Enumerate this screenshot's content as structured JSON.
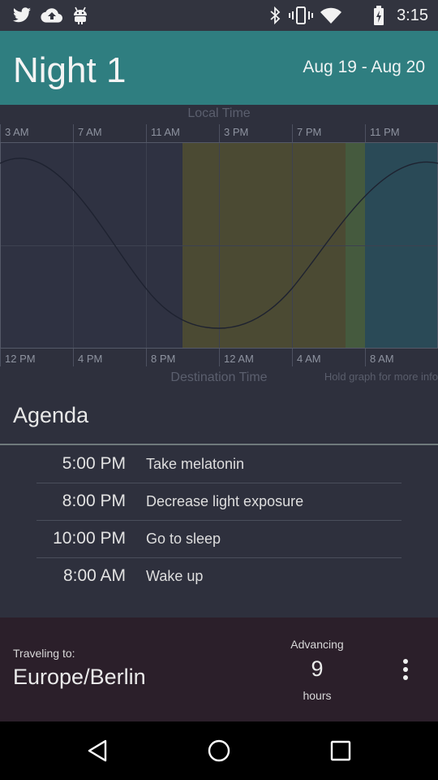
{
  "status_bar": {
    "time": "3:15",
    "left_icons": [
      "twitter-icon",
      "cloud-upload-icon",
      "android-icon"
    ],
    "right_icons": [
      "bluetooth-icon",
      "vibrate-icon",
      "wifi-icon",
      "battery-charging-icon"
    ]
  },
  "header": {
    "title": "Night 1",
    "date_range": "Aug 19 - Aug 20",
    "color": "#2f7e80"
  },
  "graph": {
    "top_axis_label": "Local Time",
    "bottom_axis_label": "Destination Time",
    "hint": "Hold graph for more info",
    "top_ticks": [
      "3 AM",
      "7 AM",
      "11 AM",
      "3 PM",
      "7 PM",
      "11 PM"
    ],
    "bottom_ticks": [
      "12 PM",
      "4 PM",
      "8 PM",
      "12 AM",
      "4 AM",
      "8 AM"
    ],
    "colors": {
      "olive_region": "#4b4a33",
      "green_region": "#455a3e",
      "teal_region": "#2a4a57",
      "curve": "#222632",
      "grid": "#3d4150"
    }
  },
  "agenda": {
    "title": "Agenda",
    "items": [
      {
        "time": "5:00 PM",
        "text": "Take melatonin"
      },
      {
        "time": "8:00 PM",
        "text": "Decrease light exposure"
      },
      {
        "time": "10:00 PM",
        "text": "Go to sleep"
      },
      {
        "time": "8:00 AM",
        "text": "Wake up"
      }
    ]
  },
  "footer": {
    "traveling_label": "Traveling to:",
    "destination": "Europe/Berlin",
    "advancing_label": "Advancing",
    "advancing_value": "9",
    "advancing_unit": "hours",
    "menu_icon": "more-vertical-icon"
  },
  "nav": {
    "back_icon": "back-triangle-icon",
    "home_icon": "home-circle-icon",
    "recents_icon": "recents-square-icon"
  }
}
